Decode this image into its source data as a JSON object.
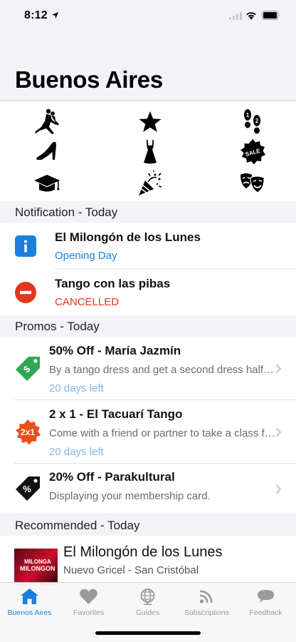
{
  "status_bar": {
    "time": "8:12",
    "icons": [
      "location-arrow-icon",
      "signal-icon",
      "wifi-icon",
      "battery-icon"
    ]
  },
  "page": {
    "title": "Buenos Aires"
  },
  "categories": [
    {
      "icon": "tango-dancers-icon"
    },
    {
      "icon": "star-icon"
    },
    {
      "icon": "footprints-icon"
    },
    {
      "icon": "high-heel-shoe-icon"
    },
    {
      "icon": "dress-icon"
    },
    {
      "icon": "sale-badge-icon",
      "text": "SALE"
    },
    {
      "icon": "graduation-cap-icon"
    },
    {
      "icon": "party-popper-icon"
    },
    {
      "icon": "theater-masks-icon"
    }
  ],
  "notifications": {
    "header": "Notification - Today",
    "items": [
      {
        "title": "El Milongón de los Lunes",
        "subtitle": "Opening Day",
        "icon": "info-icon",
        "color": "#1a7fe0"
      },
      {
        "title": "Tango con las pibas",
        "subtitle": "CANCELLED",
        "icon": "cancel-icon",
        "color": "#e0361f"
      }
    ]
  },
  "promos": {
    "header": "Promos - Today",
    "items": [
      {
        "title": "50% Off - María Jazmín",
        "description": "By a tango dress and get a second dress half price",
        "days_left": "20 days left",
        "icon": "discount-tag-icon"
      },
      {
        "title": "2 x 1 - El Tacuarí Tango",
        "description": "Come with a friend or partner to take a class for free",
        "days_left": "20 days left",
        "icon": "two-for-one-badge-icon",
        "badge_text": "2x1"
      },
      {
        "title": "20% Off - Parakultural",
        "description": "Displaying your membership card.",
        "days_left": "",
        "icon": "percent-tag-icon",
        "badge_text": "%"
      }
    ]
  },
  "recommended": {
    "header": "Recommended - Today",
    "items": [
      {
        "title": "El Milongón de los Lunes",
        "subtitle": "Nuevo Gricel - San Cristóbal",
        "thumb_line1": "MILONGA",
        "thumb_line2": "MILONGON"
      }
    ]
  },
  "tab_bar": {
    "active": 0,
    "tabs": [
      {
        "label": "Buenos Aires",
        "icon": "home-icon"
      },
      {
        "label": "Favorites",
        "icon": "heart-icon"
      },
      {
        "label": "Guides",
        "icon": "globe-icon"
      },
      {
        "label": "Subscriptions",
        "icon": "rss-icon"
      },
      {
        "label": "Feedback",
        "icon": "chat-bubble-icon"
      }
    ]
  },
  "colors": {
    "accent": "#1a7fe0",
    "danger": "#e0361f",
    "promo_green": "#2fa84f",
    "promo_orange": "#e8501b",
    "days_left": "#7fb8e8"
  }
}
